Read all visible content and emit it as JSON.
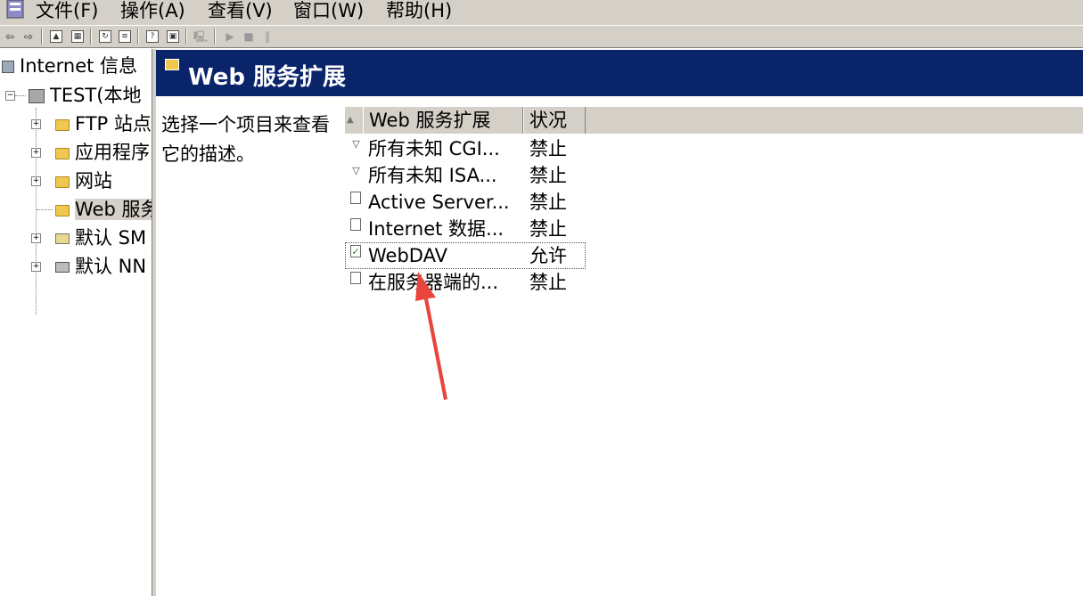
{
  "menubar": {
    "items": [
      "文件(F)",
      "操作(A)",
      "查看(V)",
      "窗口(W)",
      "帮助(H)"
    ]
  },
  "toolbar": {
    "icons": [
      "back-icon",
      "forward-icon",
      "up-folder-icon",
      "show-tree-icon",
      "refresh-icon",
      "export-icon",
      "help-icon",
      "properties-icon",
      "computer-icon",
      "play-icon",
      "stop-icon",
      "pause-icon"
    ]
  },
  "tree": {
    "root": "Internet 信息",
    "server": "TEST(本地",
    "children": [
      {
        "label": "FTP 站点",
        "icon": "folder-icon"
      },
      {
        "label": "应用程序",
        "icon": "folder-icon"
      },
      {
        "label": "网站",
        "icon": "folder-icon"
      },
      {
        "label": "Web 服务",
        "icon": "folder-icon",
        "selected": true
      },
      {
        "label": "默认 SM",
        "icon": "smtp-icon"
      },
      {
        "label": "默认 NN",
        "icon": "nntp-icon"
      }
    ]
  },
  "header": {
    "title": "Web 服务扩展"
  },
  "description": "选择一个项目来查看它的描述。",
  "table": {
    "columns": [
      "Web 服务扩展",
      "状况"
    ],
    "rows": [
      {
        "name": "所有未知 CGI...",
        "status": "禁止",
        "icon": "filter-icon"
      },
      {
        "name": "所有未知 ISA...",
        "status": "禁止",
        "icon": "filter-icon"
      },
      {
        "name": "Active Server...",
        "status": "禁止",
        "icon": "extension-prohibited-icon"
      },
      {
        "name": "Internet 数据...",
        "status": "禁止",
        "icon": "extension-prohibited-icon"
      },
      {
        "name": "WebDAV",
        "status": "允许",
        "icon": "extension-allowed-icon"
      },
      {
        "name": "在服务器端的...",
        "status": "禁止",
        "icon": "extension-prohibited-icon"
      }
    ]
  },
  "colors": {
    "header_bg": "#0a246a",
    "chrome": "#d4d0c8",
    "annotation_arrow": "#e8453c"
  }
}
